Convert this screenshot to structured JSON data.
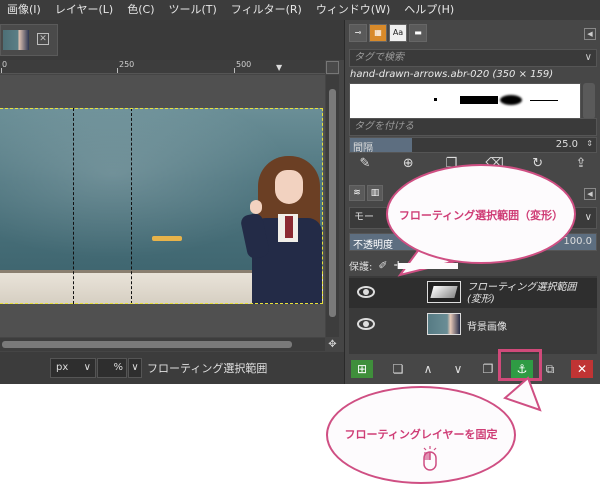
{
  "menubar": {
    "items": [
      "画像(I)",
      "レイヤー(L)",
      "色(C)",
      "ツール(T)",
      "フィルター(R)",
      "ウィンドウ(W)",
      "ヘルプ(H)"
    ]
  },
  "ruler": {
    "labels": [
      "0",
      "250",
      "500"
    ]
  },
  "statusbar": {
    "unit": "px",
    "zoom": "%",
    "message": "フローティング選択範囲"
  },
  "brushes": {
    "tag_search_placeholder": "タグで検索",
    "brush_name": "hand-drawn-arrows.abr-020 (350 × 159)",
    "tag_assign_placeholder": "タグを付ける",
    "spacing_label": "間隔",
    "spacing_value": "25.0",
    "spacing_fraction": 0.25
  },
  "layers": {
    "mode_label": "モー",
    "opacity_label": "不透明度",
    "opacity_value": "100.0",
    "lock_label": "保護:",
    "items": [
      {
        "name": "フローティング選択範囲\n(変形)",
        "selected": true,
        "visible": true
      },
      {
        "name": "背景画像",
        "selected": false,
        "visible": true
      }
    ]
  },
  "callouts": {
    "top": "フローティング選択範囲（変形）",
    "bottom": "フローティングレイヤーを固定"
  },
  "colors": {
    "accent_pink": "#cf4f83",
    "anchor_green": "#2f9c44",
    "delete_red": "#c03434"
  }
}
